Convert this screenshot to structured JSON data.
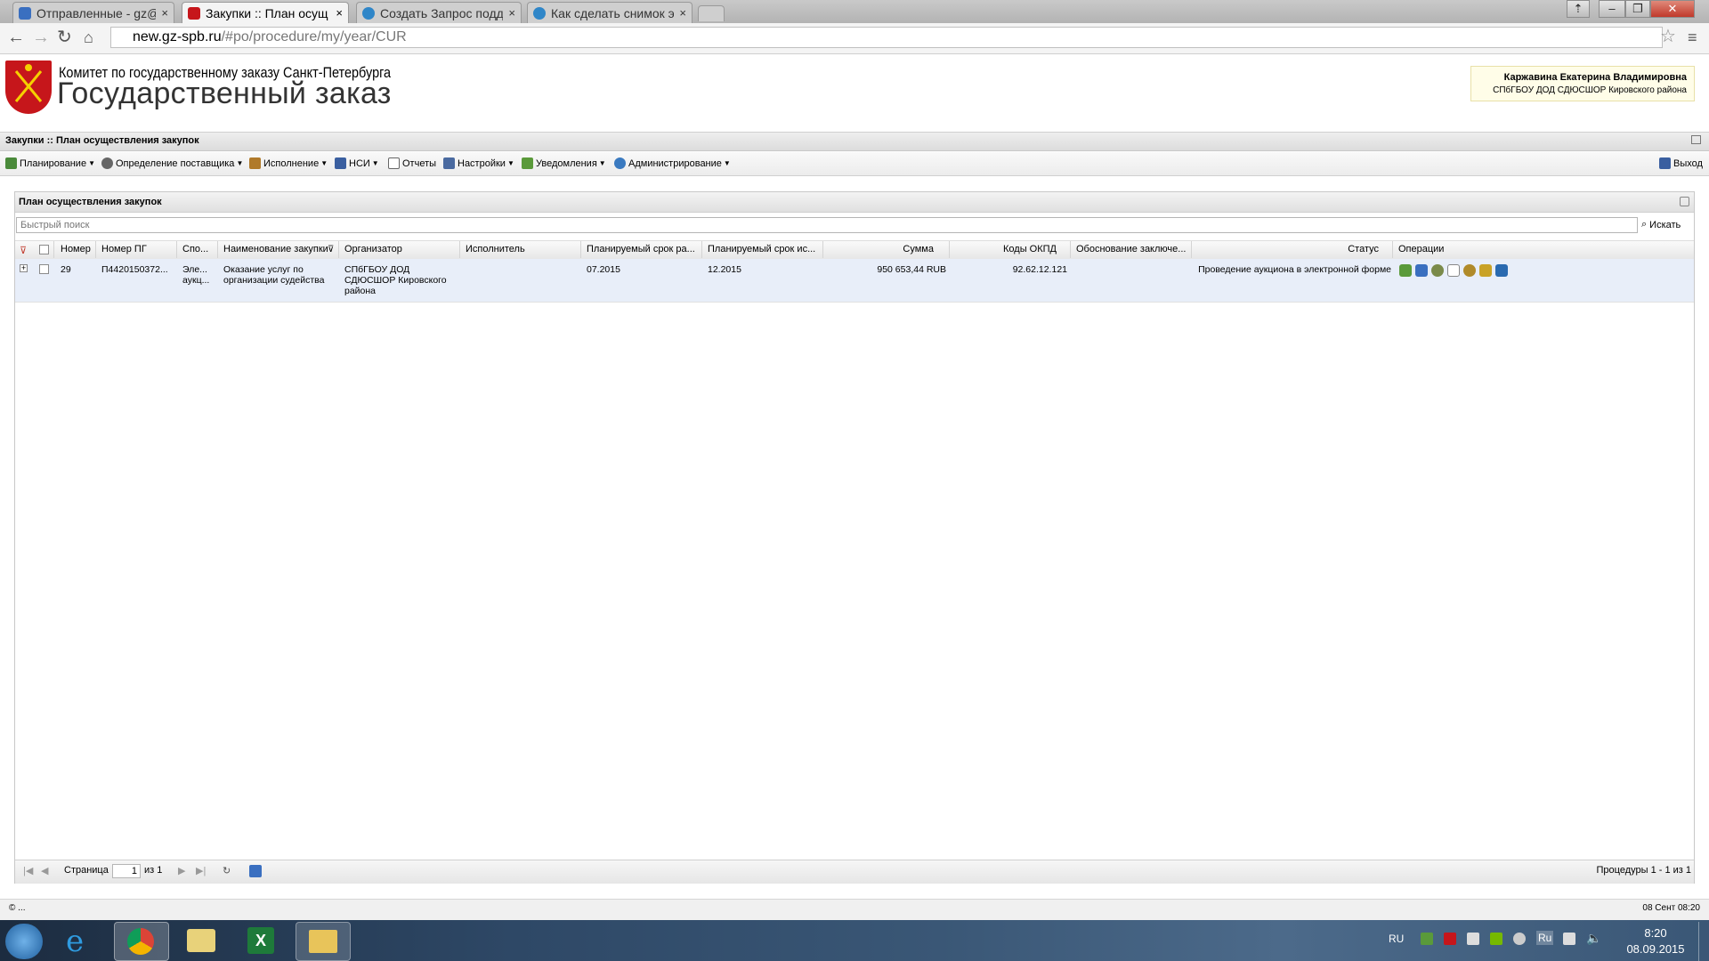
{
  "browser": {
    "tabs": [
      {
        "title": "Отправленные - gz@",
        "active": false
      },
      {
        "title": "Закупки :: План осущ",
        "active": true
      },
      {
        "title": "Создать Запрос подд",
        "active": false
      },
      {
        "title": "Как сделать снимок э",
        "active": false
      }
    ],
    "tab_close": "×",
    "url_host": "new.gz-spb.ru",
    "url_path": "/#po/procedure/my/year/CUR"
  },
  "header": {
    "org_name": "Комитет по государственному заказу Санкт-Петербурга",
    "site_name": "Государственный заказ",
    "user_name": "Каржавина Екатерина Владимировна",
    "user_org": "СПбГБОУ ДОД СДЮСШОР Кировского района"
  },
  "breadcrumb": "Закупки :: План осуществления закупок",
  "menu": {
    "items": [
      {
        "label": "Планирование",
        "color": "#4a8a3a"
      },
      {
        "label": "Определение поставщика",
        "color": "#555555"
      },
      {
        "label": "Исполнение",
        "color": "#b07a2a"
      },
      {
        "label": "НСИ",
        "color": "#3a5fa0"
      },
      {
        "label": "Отчеты",
        "color": "#666666"
      },
      {
        "label": "Настройки",
        "color": "#4a6aa0"
      },
      {
        "label": "Уведомления",
        "color": "#5a9a3a"
      },
      {
        "label": "Администрирование",
        "color": "#3a7ac0"
      }
    ],
    "logout": "Выход"
  },
  "grid": {
    "title": "План осуществления закупок",
    "search_placeholder": "Быстрый поиск",
    "search_button": "Искать",
    "columns": [
      "Номер",
      "Номер ПГ",
      "Спо...",
      "Наименование закупки",
      "Организатор",
      "Исполнитель",
      "Планируемый срок ра...",
      "Планируемый срок ис...",
      "Сумма",
      "Коды ОКПД",
      "Обоснование заключе...",
      "Статус",
      "Операции"
    ],
    "rows": [
      {
        "number": "29",
        "pg_number": "П4420150372...",
        "method": "Эле... аукц...",
        "name": "Оказание услуг по организации судейства",
        "organizer": "СПбГБОУ ДОД СДЮСШОР Кировского района",
        "executor": "",
        "plan_start": "07.2015",
        "plan_end": "12.2015",
        "sum": "950 653,44 RUB",
        "okpd": "92.62.12.121",
        "basis": "",
        "status": "Проведение аукциона в электронной форме"
      }
    ],
    "paging": {
      "page_label": "Страница",
      "page_value": "1",
      "of_label": "из 1",
      "summary": "Процедуры 1 - 1 из 1"
    }
  },
  "statusbar": {
    "left": "© ...",
    "right": "08 Сент 08:20"
  },
  "taskbar": {
    "lang": "RU",
    "kb": "Ru",
    "time": "8:20",
    "date": "08.09.2015"
  },
  "colors": {
    "row_selected": "#e8eef9",
    "logo_red": "#c6161b"
  }
}
